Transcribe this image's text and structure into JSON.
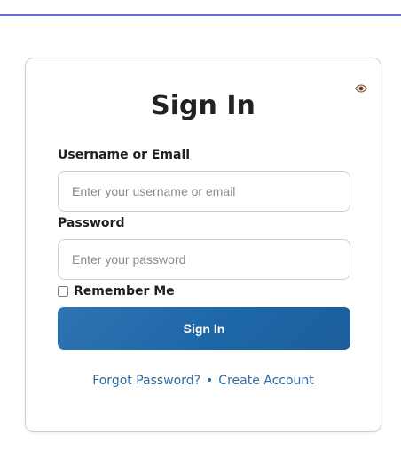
{
  "title": "Sign In",
  "username": {
    "label": "Username or Email",
    "placeholder": "Enter your username or email",
    "value": ""
  },
  "password": {
    "label": "Password",
    "placeholder": "Enter your password",
    "value": ""
  },
  "remember": {
    "label": "Remember Me",
    "checked": false
  },
  "button": {
    "label": "Sign In",
    "color": "#1d67a8"
  },
  "links": {
    "forgot": "Forgot Password?",
    "separator": "•",
    "create": "Create Account",
    "color": "#2e6aa3"
  },
  "icons": {
    "eye": "eye-icon"
  },
  "accent": {
    "topLine": "#6b6bd6"
  }
}
